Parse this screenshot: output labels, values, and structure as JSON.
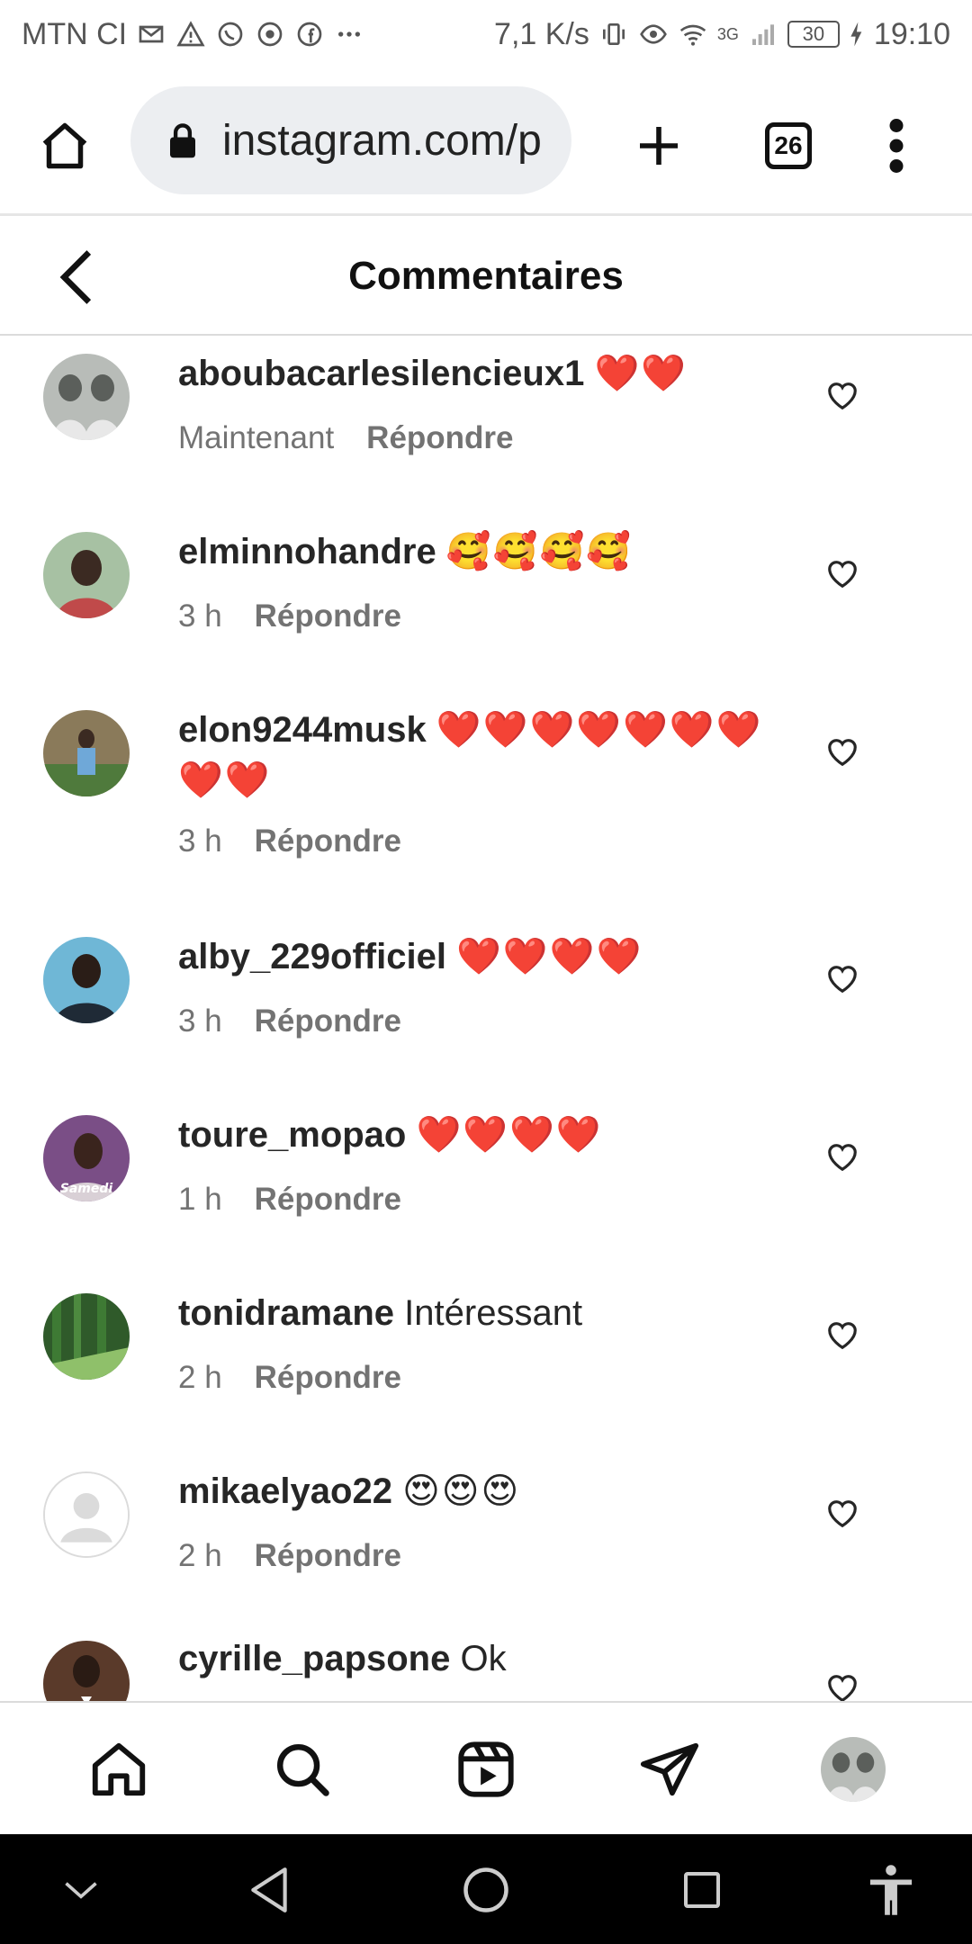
{
  "status_bar": {
    "carrier": "MTN CI",
    "speed": "7,1 K/s",
    "network": "3G",
    "battery": "30",
    "time": "19:10"
  },
  "browser": {
    "url": "instagram.com/p",
    "tab_count": "26"
  },
  "header": {
    "title": "Commentaires"
  },
  "comments": [
    {
      "username": "aboubacarlesilencieux1",
      "text": "",
      "emoji": "❤️❤️",
      "time": "Maintenant",
      "reply": "Répondre"
    },
    {
      "username": "elminnohandre",
      "text": "",
      "emoji": "🥰🥰🥰🥰",
      "time": "3 h",
      "reply": "Répondre"
    },
    {
      "username": "elon9244musk",
      "text": "",
      "emoji": "❤️❤️❤️❤️❤️❤️❤️❤️❤️",
      "time": "3 h",
      "reply": "Répondre"
    },
    {
      "username": "alby_229officiel",
      "text": "",
      "emoji": "❤️❤️❤️❤️",
      "time": "3 h",
      "reply": "Répondre"
    },
    {
      "username": "toure_mopao",
      "text": "",
      "emoji": "❤️❤️❤️❤️",
      "time": "1 h",
      "reply": "Répondre"
    },
    {
      "username": "tonidramane",
      "text": "Intéressant",
      "emoji": "",
      "time": "2 h",
      "reply": "Répondre"
    },
    {
      "username": "mikaelyao22",
      "text": "",
      "emoji": "😍😍😍",
      "time": "2 h",
      "reply": "Répondre"
    },
    {
      "username": "cyrille_papsone",
      "text": "Ok",
      "emoji": "",
      "time": "",
      "reply": ""
    }
  ],
  "avatar_overlay_text": "Samedi",
  "colors": {
    "text": "#262626",
    "meta": "#737373",
    "divider": "#dbdbdb",
    "url_bg": "#eceef1"
  }
}
